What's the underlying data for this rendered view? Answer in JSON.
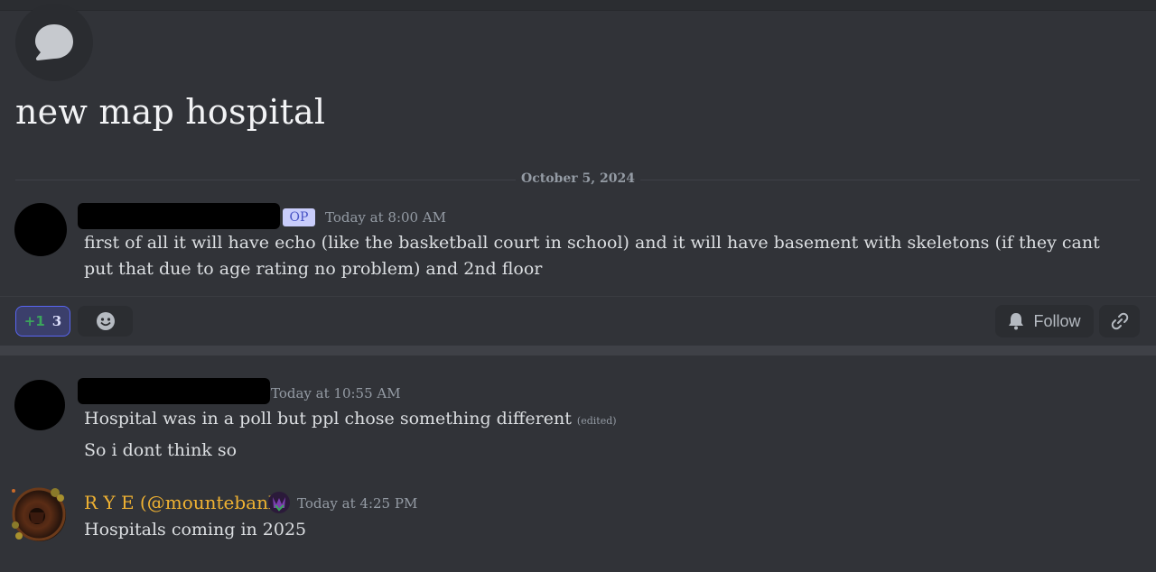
{
  "thread": {
    "title": "new map hospital",
    "date_divider": "October 5, 2024"
  },
  "messages": [
    {
      "author": "[redacted]",
      "badge": "OP",
      "timestamp": "Today at 8:00 AM",
      "text": "first of all it will have echo (like the basketball court in school)  and it will have basement with skeletons (if they cant put that due to age rating no problem) and 2nd floor"
    },
    {
      "author": "[redacted]",
      "timestamp": "Today at 10:55 AM",
      "text": "Hospital was in a poll but ppl chose something different",
      "edited_label": "(edited)",
      "text2": "So i dont think so"
    },
    {
      "author": "R Y E (@mountebank)",
      "timestamp": "Today at 4:25 PM",
      "text": "Hospitals coming in 2025"
    }
  ],
  "reactions": [
    {
      "emoji_name": "plus-one-icon",
      "emoji": "+1",
      "count": "3",
      "active": true
    }
  ],
  "actions": {
    "follow_label": "Follow",
    "add_reaction_icon": "smile-icon",
    "copy_link_icon": "link-icon"
  },
  "colors": {
    "background": "#313338",
    "accent": "#5865f2",
    "username_highlight": "#f0b232",
    "reaction_green": "#3ba55c"
  }
}
